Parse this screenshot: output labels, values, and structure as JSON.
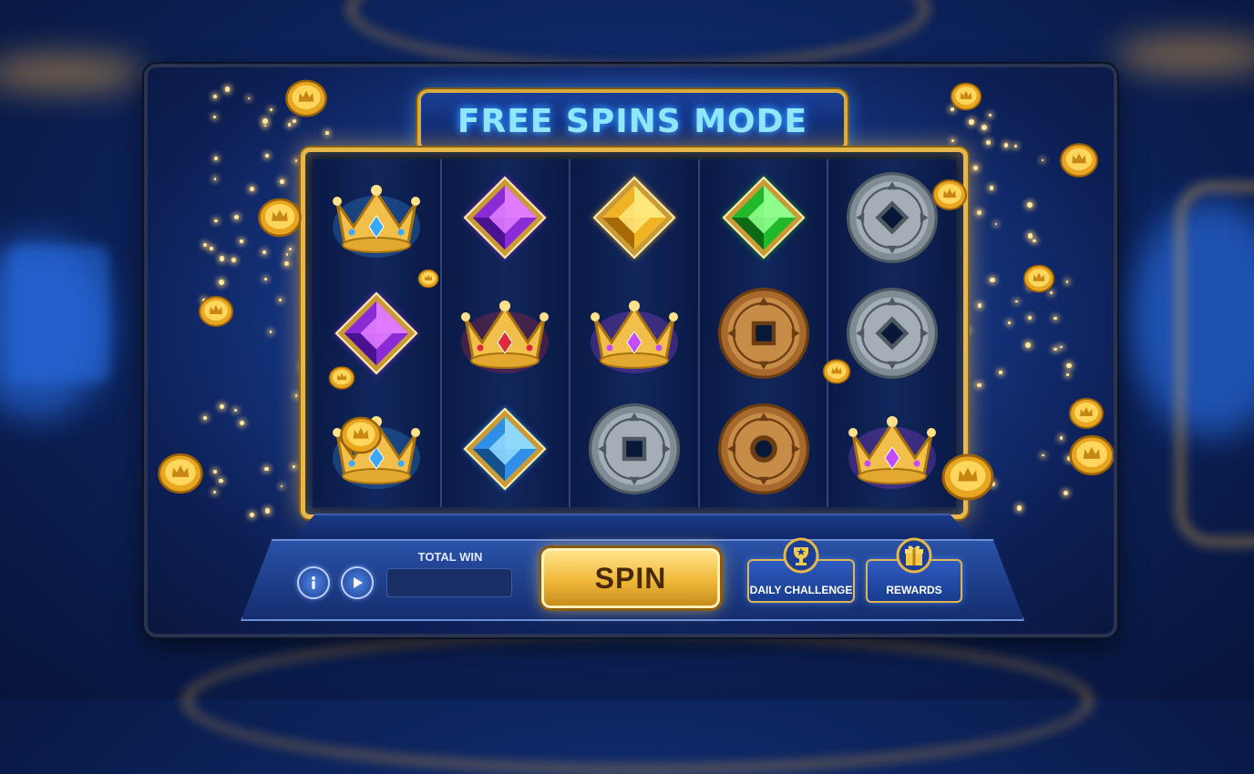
{
  "game": {
    "title": "FREE SPINS MODE",
    "reels": [
      [
        "crown-blue-gem",
        "gem-purple",
        "crown-blue-gem"
      ],
      [
        "gem-purple",
        "crown-red-gem",
        "gem-blue"
      ],
      [
        "gem-gold",
        "crown-purple-gem",
        "coin-silver-square"
      ],
      [
        "gem-green",
        "coin-bronze-square",
        "coin-bronze-ring"
      ],
      [
        "coin-silver-diamond",
        "coin-silver-diamond",
        "crown-purple-gem"
      ]
    ]
  },
  "controls": {
    "info_icon": "info-icon",
    "autoplay_icon": "play-icon",
    "total_win_label": "TOTAL WIN",
    "total_win_value": "",
    "spin_label": "SPIN",
    "daily_challenge_label": "DAILY CHALLENGE",
    "daily_challenge_icon": "trophy-icon",
    "rewards_label": "REWARDS",
    "rewards_icon": "gift-icon"
  },
  "colors": {
    "accent_gold": "#e6b84a",
    "title_glow": "#8fe6ff",
    "panel_blue": "#183c8e"
  }
}
